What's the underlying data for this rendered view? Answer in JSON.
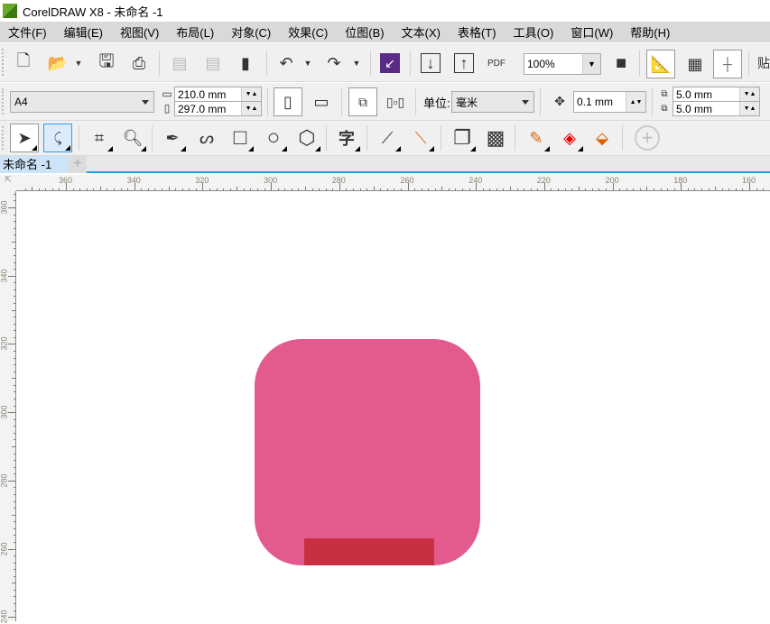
{
  "title": "CorelDRAW X8 - 未命名 -1",
  "menu": [
    "文件(F)",
    "编辑(E)",
    "视图(V)",
    "布局(L)",
    "对象(C)",
    "效果(C)",
    "位图(B)",
    "文本(X)",
    "表格(T)",
    "工具(O)",
    "窗口(W)",
    "帮助(H)"
  ],
  "toolbar": {
    "zoom": "100%",
    "pdf": "PDF",
    "snap_label": "贴"
  },
  "property_bar": {
    "page_size": "A4",
    "width": "210.0 mm",
    "height": "297.0 mm",
    "units_label": "单位:",
    "units": "毫米",
    "nudge": "0.1 mm",
    "dup_x": "5.0 mm",
    "dup_y": "5.0 mm"
  },
  "tools_icons": [
    "pick",
    "freehand-pick",
    "crop",
    "zoom",
    "pen",
    "artistic-media",
    "rectangle",
    "ellipse",
    "polygon",
    "text",
    "dimension",
    "connector",
    "drop-shadow",
    "transparency",
    "eyedropper",
    "interactive-fill",
    "smart-fill",
    "add-tool"
  ],
  "document_tab": "未命名 -1",
  "ruler": {
    "h": [
      360,
      340,
      320,
      300,
      280,
      260,
      240,
      220,
      200,
      180,
      160
    ],
    "v": [
      360,
      340,
      320,
      300,
      280,
      260,
      240
    ]
  },
  "shapes": {
    "main_color": "#e35b8e",
    "bar_color": "#c83041"
  }
}
